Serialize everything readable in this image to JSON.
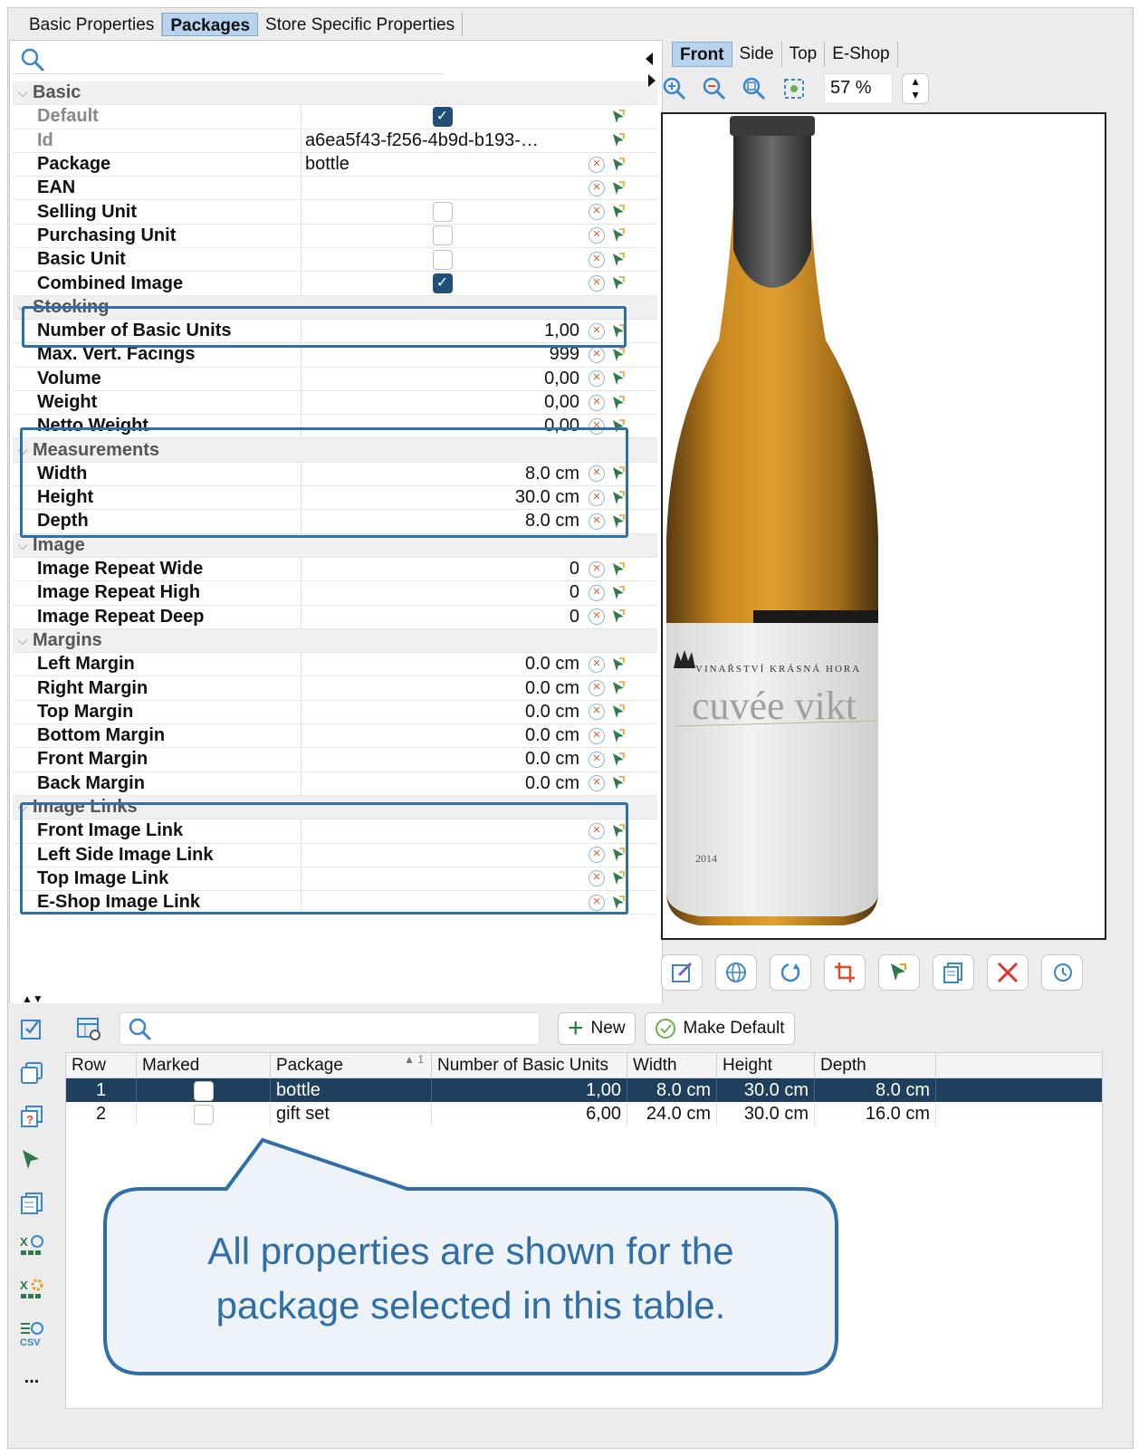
{
  "tabs": [
    "Basic Properties",
    "Packages",
    "Store Specific Properties"
  ],
  "active_tab": "Packages",
  "properties": {
    "groups": [
      {
        "title": "Basic",
        "rows": [
          {
            "label": "Default",
            "dim": true,
            "type": "check",
            "checked": true,
            "x_icon": false
          },
          {
            "label": "Id",
            "dim": true,
            "type": "text",
            "value": "a6ea5f43-f256-4b9d-b193-…",
            "x_icon": false
          },
          {
            "label": "Package",
            "type": "text",
            "value": "bottle",
            "x_icon": true
          },
          {
            "label": "EAN",
            "type": "text",
            "value": "",
            "x_icon": true
          },
          {
            "label": "Selling Unit",
            "type": "check",
            "checked": false,
            "x_icon": true
          },
          {
            "label": "Purchasing Unit",
            "type": "check",
            "checked": false,
            "x_icon": true
          },
          {
            "label": "Basic Unit",
            "type": "check",
            "checked": false,
            "x_icon": true
          },
          {
            "label": "Combined Image",
            "type": "check",
            "checked": true,
            "x_icon": true
          }
        ]
      },
      {
        "title": "Stocking",
        "rows": [
          {
            "label": "Number of Basic Units",
            "type": "num",
            "value": "1,00",
            "x_icon": true
          },
          {
            "label": "Max. Vert. Facings",
            "type": "num",
            "value": "999",
            "x_icon": true
          },
          {
            "label": "Volume",
            "type": "num",
            "value": "0,00",
            "x_icon": true
          },
          {
            "label": "Weight",
            "type": "num",
            "value": "0,00",
            "x_icon": true
          },
          {
            "label": "Netto Weight",
            "type": "num",
            "value": "0,00",
            "x_icon": true
          }
        ]
      },
      {
        "title": "Measurements",
        "rows": [
          {
            "label": "Width",
            "type": "num",
            "value": "8.0 cm",
            "x_icon": true
          },
          {
            "label": "Height",
            "type": "num",
            "value": "30.0 cm",
            "x_icon": true
          },
          {
            "label": "Depth",
            "type": "num",
            "value": "8.0 cm",
            "x_icon": true
          }
        ]
      },
      {
        "title": "Image",
        "rows": [
          {
            "label": "Image Repeat Wide",
            "type": "num",
            "value": "0",
            "x_icon": true
          },
          {
            "label": "Image Repeat High",
            "type": "num",
            "value": "0",
            "x_icon": true
          },
          {
            "label": "Image Repeat Deep",
            "type": "num",
            "value": "0",
            "x_icon": true
          }
        ]
      },
      {
        "title": "Margins",
        "rows": [
          {
            "label": "Left Margin",
            "type": "num",
            "value": "0.0 cm",
            "x_icon": true
          },
          {
            "label": "Right Margin",
            "type": "num",
            "value": "0.0 cm",
            "x_icon": true
          },
          {
            "label": "Top Margin",
            "type": "num",
            "value": "0.0 cm",
            "x_icon": true
          },
          {
            "label": "Bottom Margin",
            "type": "num",
            "value": "0.0 cm",
            "x_icon": true
          },
          {
            "label": "Front Margin",
            "type": "num",
            "value": "0.0 cm",
            "x_icon": true
          },
          {
            "label": "Back Margin",
            "type": "num",
            "value": "0.0 cm",
            "x_icon": true
          }
        ]
      },
      {
        "title": "Image Links",
        "rows": [
          {
            "label": "Front Image Link",
            "type": "text",
            "value": "",
            "x_icon": true
          },
          {
            "label": "Left Side Image Link",
            "type": "text",
            "value": "",
            "x_icon": true
          },
          {
            "label": "Top Image Link",
            "type": "text",
            "value": "",
            "x_icon": true
          },
          {
            "label": "E-Shop Image Link",
            "type": "text",
            "value": "",
            "x_icon": true
          }
        ]
      }
    ]
  },
  "view_tabs": [
    "Front",
    "Side",
    "Top",
    "E-Shop"
  ],
  "active_view_tab": "Front",
  "zoom": {
    "value": "57 %"
  },
  "bottle_label": {
    "winery": "VINAŘSTVÍ KRÁSNÁ HORA",
    "name": "cuvée vikt",
    "year": "2014"
  },
  "toolbar": {
    "new_label": "New",
    "make_default_label": "Make Default"
  },
  "sidebar_text": {
    "more": "...",
    "csv": "CSV"
  },
  "grid": {
    "columns": [
      "Row",
      "Marked",
      "Package",
      "Number of Basic Units",
      "Width",
      "Height",
      "Depth"
    ],
    "sort_indicator": "1",
    "rows": [
      {
        "row": "1",
        "marked": false,
        "package": "bottle",
        "nbu": "1,00",
        "width": "8.0 cm",
        "height": "30.0 cm",
        "depth": "8.0 cm",
        "selected": true
      },
      {
        "row": "2",
        "marked": false,
        "package": "gift set",
        "nbu": "6,00",
        "width": "24.0 cm",
        "height": "30.0 cm",
        "depth": "16.0 cm",
        "selected": false
      }
    ]
  },
  "callout": {
    "text_line1": "All properties are shown for the",
    "text_line2": "package selected in this table."
  },
  "colors": {
    "accent": "#2f6ea6",
    "selection": "#1f3f5e",
    "tab_active": "#b7d3ee"
  }
}
